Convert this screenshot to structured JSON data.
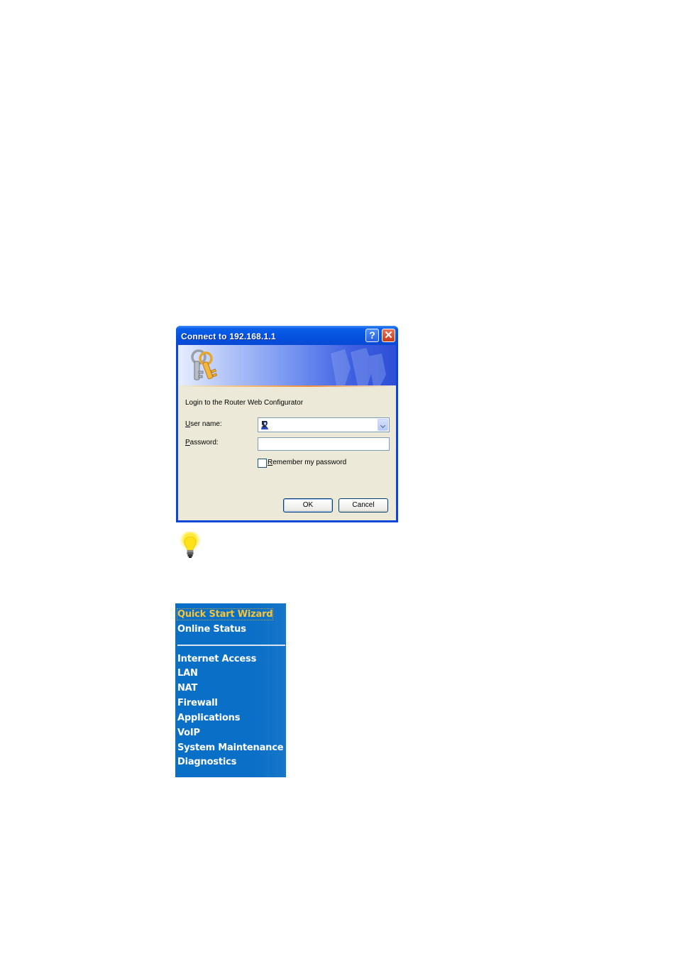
{
  "dialog": {
    "title": "Connect to 192.168.1.1",
    "help_button": "?",
    "close_button": "✕",
    "intro_text": "Login to the Router Web Configurator",
    "user_label_accel": "U",
    "user_label_rest": "ser name:",
    "user_value": "",
    "password_label_accel": "P",
    "password_label_rest": "assword:",
    "password_value": "",
    "remember_accel": "R",
    "remember_rest": "emember my password",
    "remember_checked": false,
    "ok_label": "OK",
    "cancel_label": "Cancel",
    "icons": {
      "banner": "keys-icon",
      "watermark": "keys-watermark-icon",
      "user": "user-icon",
      "dropdown": "chevron-down-icon"
    }
  },
  "tip": {
    "icon": "lightbulb-icon"
  },
  "nav_menu": {
    "items": [
      {
        "label": "Quick Start Wizard",
        "active": true
      },
      {
        "label": "Online Status",
        "active": false
      },
      {
        "label": "Internet Access",
        "active": false
      },
      {
        "label": "LAN",
        "active": false
      },
      {
        "label": "NAT",
        "active": false
      },
      {
        "label": "Firewall",
        "active": false
      },
      {
        "label": "Applications",
        "active": false
      },
      {
        "label": "VoIP",
        "active": false
      },
      {
        "label": "System Maintenance",
        "active": false
      },
      {
        "label": "Diagnostics",
        "active": false
      }
    ],
    "colors": {
      "background": "#0a6fc6",
      "text": "#ffffff",
      "active_text": "#f6c436"
    }
  }
}
